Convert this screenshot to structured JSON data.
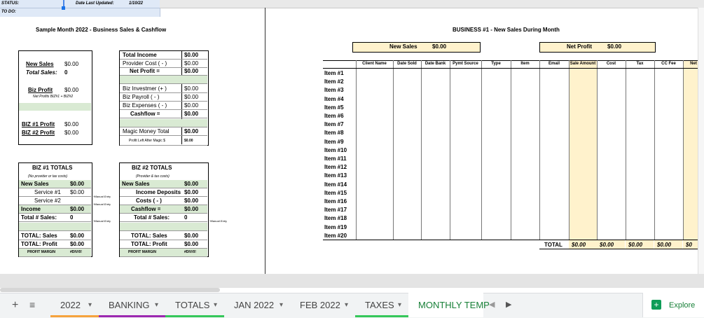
{
  "status": {
    "label": "STATUS:",
    "date_label": "Date Last Updated:",
    "date": "1/10/22",
    "todo": "TO DO:"
  },
  "left_title": "Sample Month 2022 - Business Sales & Cashflow",
  "summary": {
    "new_sales_label": "New Sales",
    "new_sales_val": "$0.00",
    "total_sales_label": "Total Sales:",
    "total_sales_val": "0",
    "biz_profit_label": "Biz Profit",
    "biz_profit_val": "$0.00",
    "biz_profit_note": "Net Profits BIZ#1 + BIZ#2",
    "biz1_label": "BIZ #1 Profit",
    "biz1_val": "$0.00",
    "biz2_label": "BIZ #2 Profit",
    "biz2_val": "$0.00"
  },
  "income": {
    "rows": [
      {
        "label": "Total Income",
        "val": "$0.00"
      },
      {
        "label": "Provider Cost  ( - )",
        "val": "$0.00"
      },
      {
        "label": "Net Profit   =",
        "val": "$0.00"
      },
      {
        "label": "",
        "val": ""
      },
      {
        "label": "Biz Investmer  (+ )",
        "val": "$0.00"
      },
      {
        "label": "Biz Payroll       ( - )",
        "val": "$0.00"
      },
      {
        "label": "Biz Expenses   ( - )",
        "val": "$0.00"
      },
      {
        "label": "Cashflow    =",
        "val": "$0.00"
      },
      {
        "label": "",
        "val": ""
      },
      {
        "label": "Magic Money Total",
        "val": "$0.00"
      },
      {
        "label": "Profit Left After Magic $",
        "val": "$0.00"
      }
    ]
  },
  "biz1": {
    "title": "BIZ #1 TOTALS",
    "note": "(No provider or tax costs)",
    "rows": [
      {
        "label": "New Sales",
        "val": "$0.00"
      },
      {
        "label": "Service #1",
        "val": "$0.00"
      },
      {
        "label": "Service #2",
        "val": ""
      },
      {
        "label": "Income",
        "val": "$0.00"
      },
      {
        "label": "Total # Sales:",
        "val": "0"
      },
      {
        "label": "",
        "val": ""
      },
      {
        "label": "TOTAL:  Sales",
        "val": "$0.00"
      },
      {
        "label": "TOTAL:  Profit",
        "val": "$0.00"
      },
      {
        "label": "PROFIT MARGIN",
        "val": "#DIV/0!"
      }
    ]
  },
  "biz2": {
    "title": "BIZ #2 TOTALS",
    "note": "(Provider & tax costs)",
    "rows": [
      {
        "label": "New Sales",
        "val": "$0.00"
      },
      {
        "label": "Income Deposits",
        "val": "$0.00"
      },
      {
        "label": "Costs     ( - )",
        "val": "$0.00"
      },
      {
        "label": "Cashflow     =",
        "val": "$0.00"
      },
      {
        "label": "Total # Sales:",
        "val": "0"
      },
      {
        "label": "",
        "val": ""
      },
      {
        "label": "TOTAL:  Sales",
        "val": "$0.00"
      },
      {
        "label": "TOTAL:  Profit",
        "val": "$0.00"
      },
      {
        "label": "PROFIT MARGIN",
        "val": "#DIV/0!"
      }
    ]
  },
  "manual_entry": "*Manual Entry",
  "right": {
    "title": "BUSINESS #1 - New Sales During Month",
    "new_sales_label": "New Sales",
    "new_sales_val": "$0.00",
    "net_profit_label": "Net Profit",
    "net_profit_val": "$0.00",
    "headers": [
      "Client Name",
      "Date Sold",
      "Date Bank",
      "Pymt Source",
      "Type",
      "Item",
      "Email",
      "Sale Amount",
      "Cost",
      "Tax",
      "CC Fee",
      "Net"
    ],
    "items": [
      "Item #1",
      "Item #2",
      "Item #3",
      "Item #4",
      "Item #5",
      "Item #6",
      "Item #7",
      "Item #8",
      "Item #9",
      "Item #10",
      "Item #11",
      "Item #12",
      "Item #13",
      "Item #14",
      "Item #15",
      "Item #16",
      "Item #17",
      "Item #18",
      "Item #19",
      "Item #20"
    ],
    "total_label": "TOTAL",
    "totals": [
      "$0.00",
      "$0.00",
      "$0.00",
      "$0.00",
      "$0"
    ]
  },
  "tabs": [
    {
      "label": "2022",
      "color": "#f6a23c"
    },
    {
      "label": "BANKING",
      "color": "#9c27b0"
    },
    {
      "label": "TOTALS",
      "color": "#34c759"
    },
    {
      "label": "JAN 2022",
      "color": ""
    },
    {
      "label": "FEB 2022",
      "color": ""
    },
    {
      "label": "TAXES",
      "color": "#34c759"
    },
    {
      "label": "MONTHLY TEMP",
      "color": ""
    }
  ],
  "explore_label": "Explore"
}
